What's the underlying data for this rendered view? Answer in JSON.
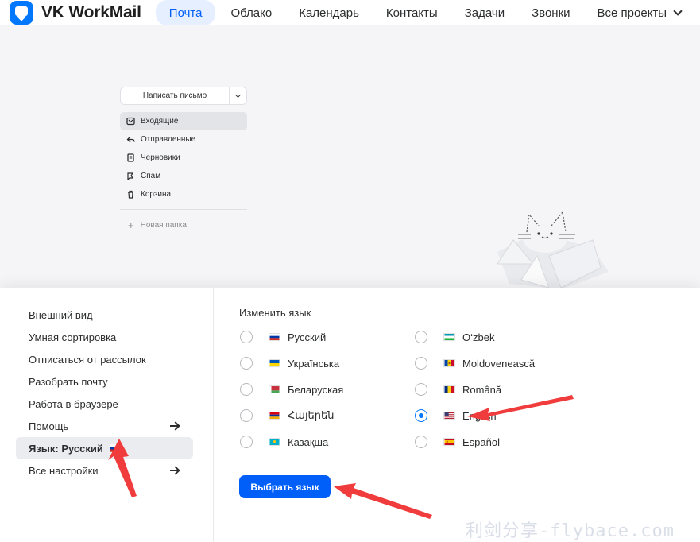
{
  "brand": {
    "name": "VK WorkMail"
  },
  "nav": {
    "items": [
      {
        "label": "Почта",
        "active": true
      },
      {
        "label": "Облако"
      },
      {
        "label": "Календарь"
      },
      {
        "label": "Контакты"
      },
      {
        "label": "Задачи"
      },
      {
        "label": "Звонки"
      },
      {
        "label": "Все проекты"
      }
    ]
  },
  "mail": {
    "compose_label": "Написать письмо",
    "folders": [
      {
        "label": "Входящие",
        "icon": "inbox-icon",
        "active": true
      },
      {
        "label": "Отправленные",
        "icon": "sent-icon"
      },
      {
        "label": "Черновики",
        "icon": "drafts-icon"
      },
      {
        "label": "Спам",
        "icon": "spam-icon"
      },
      {
        "label": "Корзина",
        "icon": "trash-icon"
      }
    ],
    "new_folder_label": "Новая папка"
  },
  "settings_menu": {
    "items": [
      {
        "label": "Внешний вид"
      },
      {
        "label": "Умная сортировка"
      },
      {
        "label": "Отписаться от рассылок"
      },
      {
        "label": "Разобрать почту"
      },
      {
        "label": "Работа в браузере"
      },
      {
        "label": "Помощь",
        "arrow": true
      },
      {
        "label": "Язык: Русский",
        "active": true,
        "flag": "ru"
      },
      {
        "label": "Все настройки",
        "arrow": true
      }
    ]
  },
  "language": {
    "title": "Изменить язык",
    "options": [
      {
        "label": "Русский",
        "flag": "ru"
      },
      {
        "label": "Українська",
        "flag": "ua"
      },
      {
        "label": "Беларуская",
        "flag": "by"
      },
      {
        "label": "Հայերեն",
        "flag": "am"
      },
      {
        "label": "Казақша",
        "flag": "kz"
      },
      {
        "label": "O‘zbek",
        "flag": "uz"
      },
      {
        "label": "Moldovenească",
        "flag": "md"
      },
      {
        "label": "Română",
        "flag": "ro"
      },
      {
        "label": "English",
        "flag": "us",
        "selected": true
      },
      {
        "label": "Español",
        "flag": "es"
      }
    ],
    "submit_label": "Выбрать язык"
  },
  "colors": {
    "accent": "#005ff9",
    "annotation_arrow": "#f03c3c"
  },
  "watermark": "利剑分享-flybace.com"
}
